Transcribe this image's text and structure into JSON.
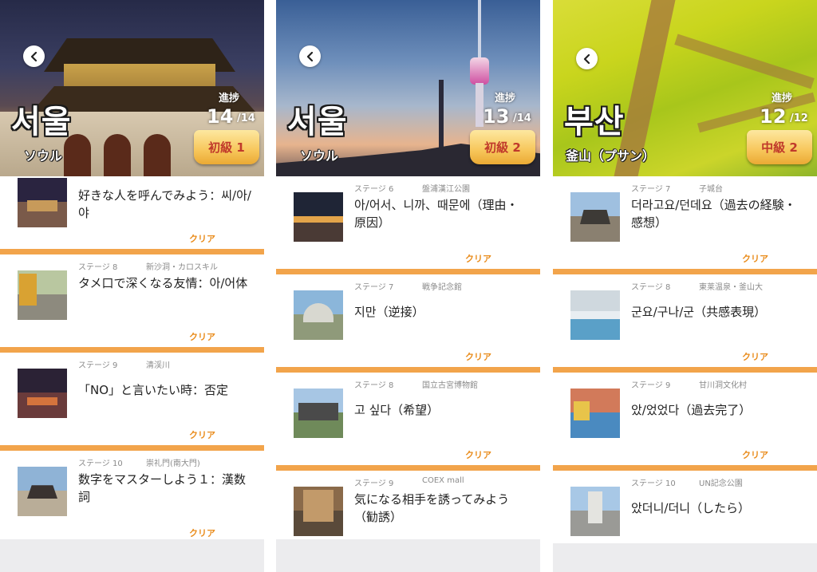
{
  "panels": [
    {
      "city": "서울",
      "city_sub": "ソウル",
      "progress_label": "進捗",
      "progress_current": "14",
      "progress_total": "/14",
      "level": "初級 1",
      "items": [
        {
          "stage": "",
          "place": "",
          "title": "好きな人を呼んでみよう：씨/아/야",
          "status": "クリア"
        },
        {
          "stage": "ステージ 8",
          "place": "新沙洞・カロスキル",
          "title": "タメ口で深くなる友情：아/어体",
          "status": "クリア"
        },
        {
          "stage": "ステージ 9",
          "place": "清渓川",
          "title": "「NO」と言いたい時：否定",
          "status": "クリア"
        },
        {
          "stage": "ステージ 10",
          "place": "崇礼門(南大門)",
          "title": "数字をマスターしよう１：漢数詞",
          "status": "クリア"
        }
      ]
    },
    {
      "city": "서울",
      "city_sub": "ソウル",
      "progress_label": "進捗",
      "progress_current": "13",
      "progress_total": "/14",
      "level": "初級 2",
      "items": [
        {
          "stage": "ステージ 6",
          "place": "盤浦漢江公園",
          "title": "아/어서、니까、때문에（理由・原因）",
          "status": "クリア"
        },
        {
          "stage": "ステージ 7",
          "place": "戦争記念館",
          "title": "지만（逆接）",
          "status": "クリア"
        },
        {
          "stage": "ステージ 8",
          "place": "国立古宮博物館",
          "title": "고 싶다（希望）",
          "status": "クリア"
        },
        {
          "stage": "ステージ 9",
          "place": "COEX mall",
          "title": "気になる相手を誘ってみよう（勧誘）",
          "status": ""
        }
      ]
    },
    {
      "city": "부산",
      "city_sub": "釜山（プサン）",
      "progress_label": "進捗",
      "progress_current": "12",
      "progress_total": "/12",
      "level": "中級 2",
      "items": [
        {
          "stage": "ステージ 7",
          "place": "子城台",
          "title": "더라고요/던데요（過去の経験・感想）",
          "status": "クリア"
        },
        {
          "stage": "ステージ 8",
          "place": "東莱温泉・釜山大",
          "title": "군요/구나/군（共感表現）",
          "status": "クリア"
        },
        {
          "stage": "ステージ 9",
          "place": "甘川洞文化村",
          "title": "았/었었다（過去完了）",
          "status": "クリア"
        },
        {
          "stage": "ステージ 10",
          "place": "UN記念公園",
          "title": "았더니/더니（したら）",
          "status": ""
        }
      ]
    }
  ],
  "colors": {
    "accent_orange": "#f2a44b",
    "clear_text": "#e98b1a",
    "badge_text": "#c0392b",
    "badge_gold": "#f7c65a"
  },
  "icons": {
    "back": "chevron-left-icon"
  }
}
